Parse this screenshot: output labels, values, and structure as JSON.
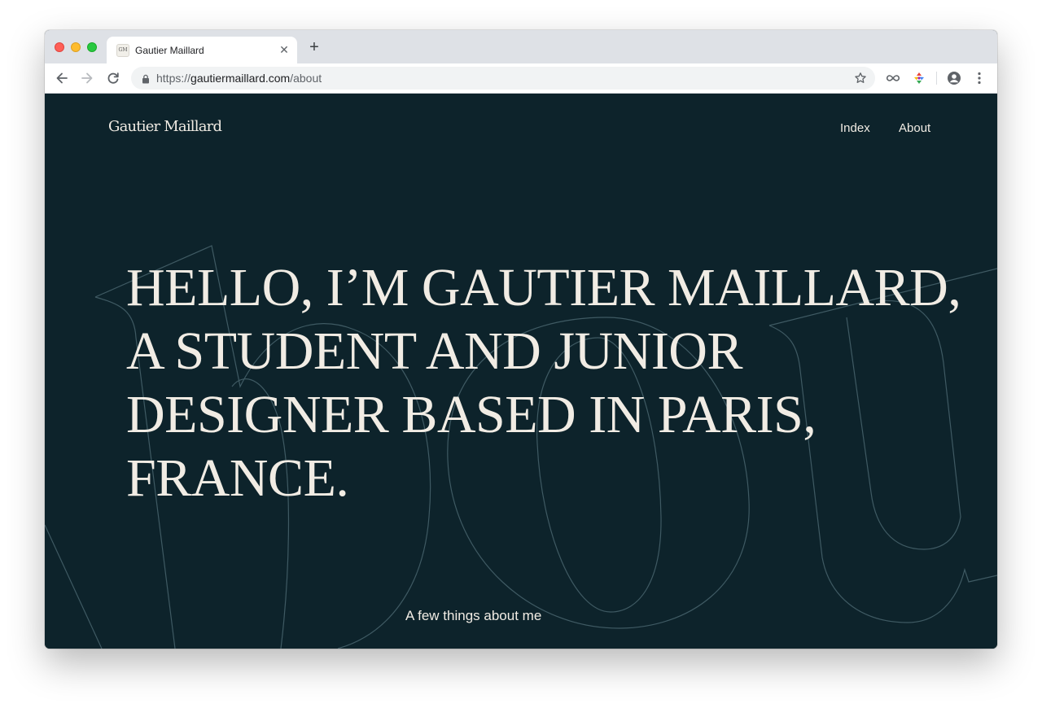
{
  "browser": {
    "tab": {
      "favicon_text": "GM",
      "title": "Gautier Maillard"
    },
    "new_tab_label": "+",
    "url": {
      "scheme": "https://",
      "domain": "gautiermaillard.com",
      "path": "/about"
    }
  },
  "page": {
    "brand": "Gautier Maillard",
    "nav": {
      "index_label": "Index",
      "about_label": "About"
    },
    "hero_lines": [
      "HELLO, I’M GAUTIER MAILLARD,",
      "A STUDENT AND JUNIOR",
      "DESIGNER BASED IN PARIS,",
      "FRANCE."
    ],
    "subtitle": "A few things about me"
  },
  "colors": {
    "page_background": "#0d232b",
    "page_text": "#f1ece4",
    "outline_word": "#3f5a63",
    "chrome_tabstrip": "#dee1e6"
  },
  "icons": {
    "back": "arrow-left-icon",
    "forward": "arrow-right-icon",
    "reload": "reload-icon",
    "lock": "lock-icon",
    "bookmark": "star-icon",
    "extension_1": "infinity-icon",
    "extension_2": "puzzle-color-icon",
    "profile": "account-circle-icon",
    "menu": "kebab-menu-icon"
  }
}
